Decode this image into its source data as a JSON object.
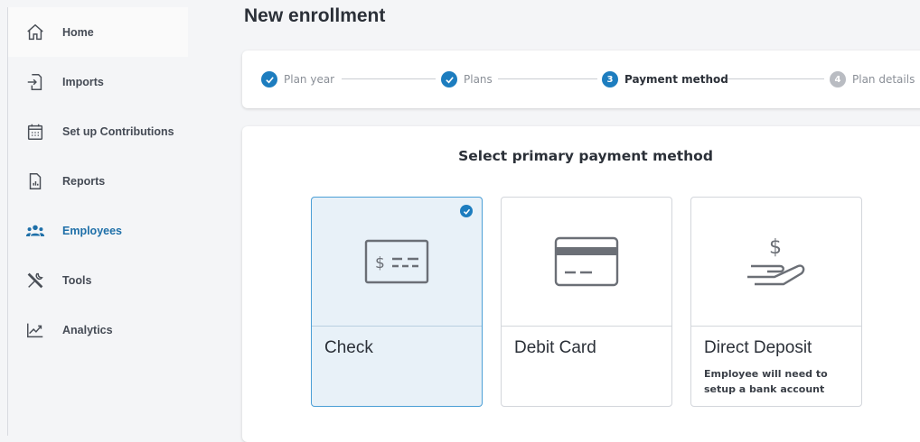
{
  "sidebar": {
    "items": [
      {
        "label": "Home",
        "icon": "home-icon"
      },
      {
        "label": "Imports",
        "icon": "import-icon"
      },
      {
        "label": "Set up Contributions",
        "icon": "calendar-icon"
      },
      {
        "label": "Reports",
        "icon": "report-icon"
      },
      {
        "label": "Employees",
        "icon": "people-icon",
        "active": true
      },
      {
        "label": "Tools",
        "icon": "tools-icon"
      },
      {
        "label": "Analytics",
        "icon": "chart-icon"
      }
    ]
  },
  "page": {
    "title": "New enrollment"
  },
  "stepper": {
    "steps": [
      {
        "label": "Plan year",
        "state": "done",
        "marker": ""
      },
      {
        "label": "Plans",
        "state": "done",
        "marker": ""
      },
      {
        "label": "Payment method",
        "state": "current",
        "marker": "3"
      },
      {
        "label": "Plan details",
        "state": "todo",
        "marker": "4"
      }
    ]
  },
  "payment": {
    "title": "Select primary payment method",
    "options": [
      {
        "label": "Check",
        "icon": "check-icon",
        "selected": true,
        "sub": ""
      },
      {
        "label": "Debit Card",
        "icon": "card-icon",
        "selected": false,
        "sub": ""
      },
      {
        "label": "Direct Deposit",
        "icon": "deposit-icon",
        "selected": false,
        "sub": "Employee will need to setup a bank account"
      }
    ]
  },
  "colors": {
    "accent": "#1d7dbf",
    "active_nav": "#1e6fa8"
  }
}
